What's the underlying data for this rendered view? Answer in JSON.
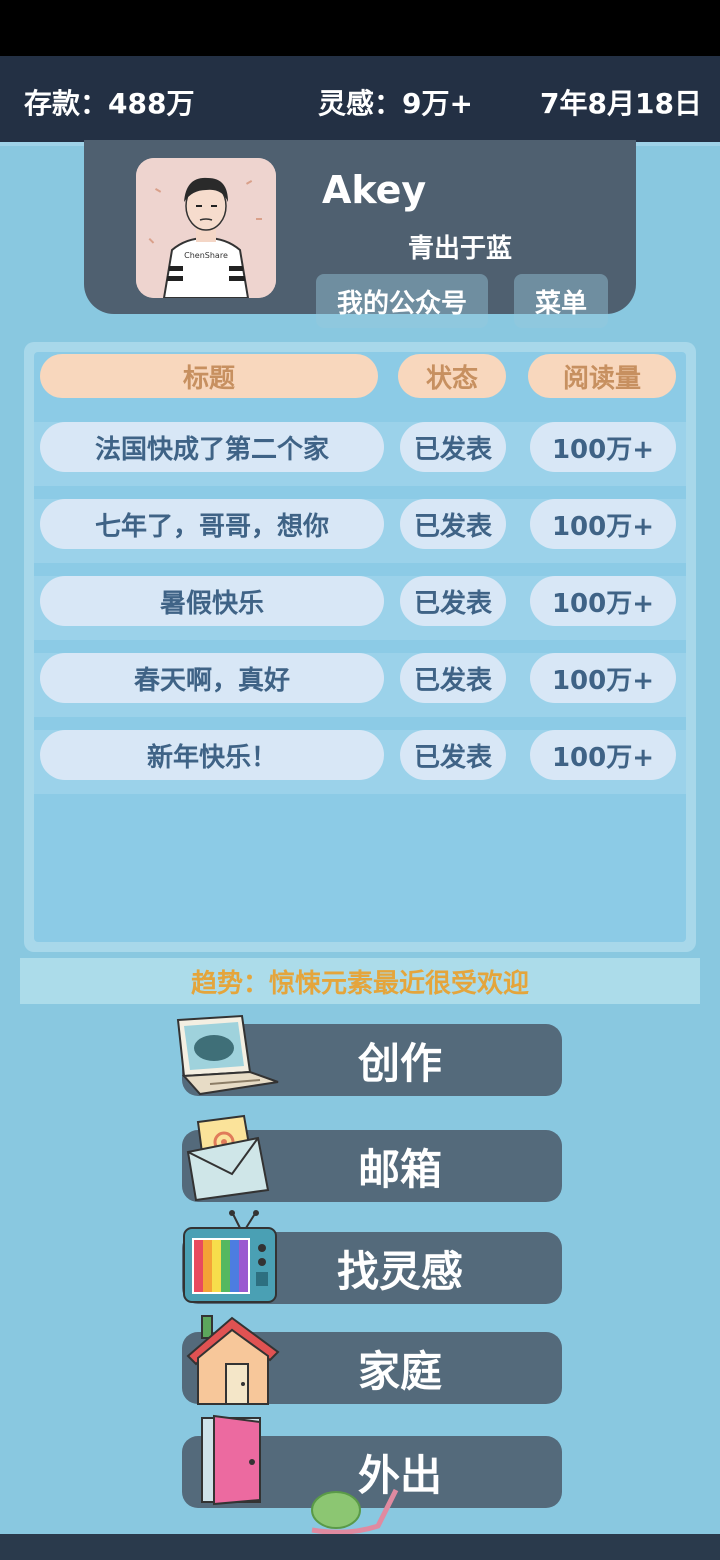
{
  "topbar": {
    "savings": "存款：488万",
    "inspiration": "灵感：9万+",
    "date": "7年8月18日"
  },
  "profile": {
    "name": "Akey",
    "motto": "青出于蓝",
    "avatar_shirt_text": "ChenShare",
    "btn_account": "我的公众号",
    "btn_menu": "菜单"
  },
  "table": {
    "headers": [
      "标题",
      "状态",
      "阅读量"
    ],
    "rows": [
      {
        "title": "法国快成了第二个家",
        "status": "已发表",
        "reads": "100万+"
      },
      {
        "title": "七年了，哥哥，想你",
        "status": "已发表",
        "reads": "100万+"
      },
      {
        "title": "暑假快乐",
        "status": "已发表",
        "reads": "100万+"
      },
      {
        "title": "春天啊，真好",
        "status": "已发表",
        "reads": "100万+"
      },
      {
        "title": "新年快乐！",
        "status": "已发表",
        "reads": "100万+"
      }
    ]
  },
  "trend": "趋势：惊悚元素最近很受欢迎",
  "menu": [
    {
      "label": "创作",
      "icon": "laptop-icon"
    },
    {
      "label": "邮箱",
      "icon": "envelope-icon"
    },
    {
      "label": "找灵感",
      "icon": "tv-icon"
    },
    {
      "label": "家庭",
      "icon": "house-icon"
    },
    {
      "label": "外出",
      "icon": "door-icon"
    }
  ],
  "colors": {
    "background": "#89c8e0",
    "topbar": "#233044",
    "panel": "#4f6070",
    "header_pill": "#f8d7bd",
    "cell_pill": "#d8e7f6",
    "trend_text": "#e4a53c"
  }
}
